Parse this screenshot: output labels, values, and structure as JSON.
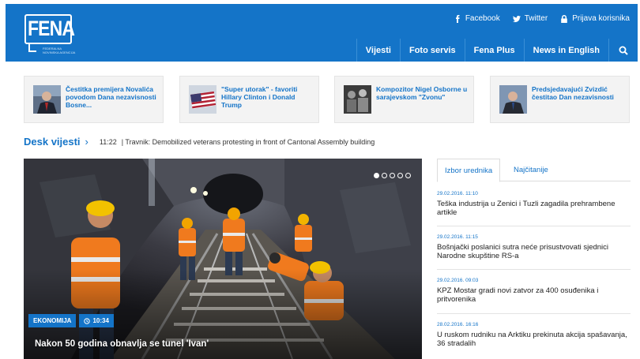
{
  "header": {
    "logo_text": "FENA",
    "logo_subtext": "FEDERALNA NOVINSKA AGENCIJA",
    "top_links": [
      {
        "label": "Facebook",
        "icon": "facebook-icon"
      },
      {
        "label": "Twitter",
        "icon": "twitter-icon"
      },
      {
        "label": "Prijava korisnika",
        "icon": "lock-icon"
      }
    ],
    "nav": [
      "Vijesti",
      "Foto servis",
      "Fena Plus",
      "News in English"
    ],
    "search_icon": "search-icon",
    "brand_color": "#1474c8"
  },
  "teasers": [
    {
      "text": "Čestitka premijera Novalića povodom Dana nezavisnosti Bosne..."
    },
    {
      "text": "\"Super utorak\" - favoriti Hillary Clinton i Donald Trump"
    },
    {
      "text": "Kompozitor Nigel Osborne u sarajevskom \"Zvonu\""
    },
    {
      "text": "Predsjedavajući Zvizdić čestitao Dan nezavisnosti"
    }
  ],
  "desk": {
    "title": "Desk vijesti",
    "time": "11:22",
    "text": "| Travnik: Demobilized veterans protesting in front of Cantonal Assembly building"
  },
  "hero": {
    "category": "EKONOMIJA",
    "time": "10:34",
    "title": "Nakon 50 godina obnavlja se tunel 'Ivan'",
    "slides_total": 5,
    "active_slide": 1
  },
  "sidebar": {
    "tabs": [
      "Izbor urednika",
      "Najčitanije"
    ],
    "active_tab": 0,
    "news": [
      {
        "date": "29.02.2016. 11:10",
        "title": "Teška industrija u Zenici i Tuzli zagadila prehrambene artikle"
      },
      {
        "date": "29.02.2016. 11:15",
        "title": "Bošnjački poslanici sutra neće prisustvovati sjednici Narodne skupštine RS-a"
      },
      {
        "date": "29.02.2016. 09:03",
        "title": "KPZ Mostar gradi novi zatvor za 400 osuđenika i pritvorenika"
      },
      {
        "date": "28.02.2016. 16:16",
        "title": "U ruskom rudniku na Arktiku prekinuta akcija spašavanja, 36 stradalih"
      }
    ]
  }
}
